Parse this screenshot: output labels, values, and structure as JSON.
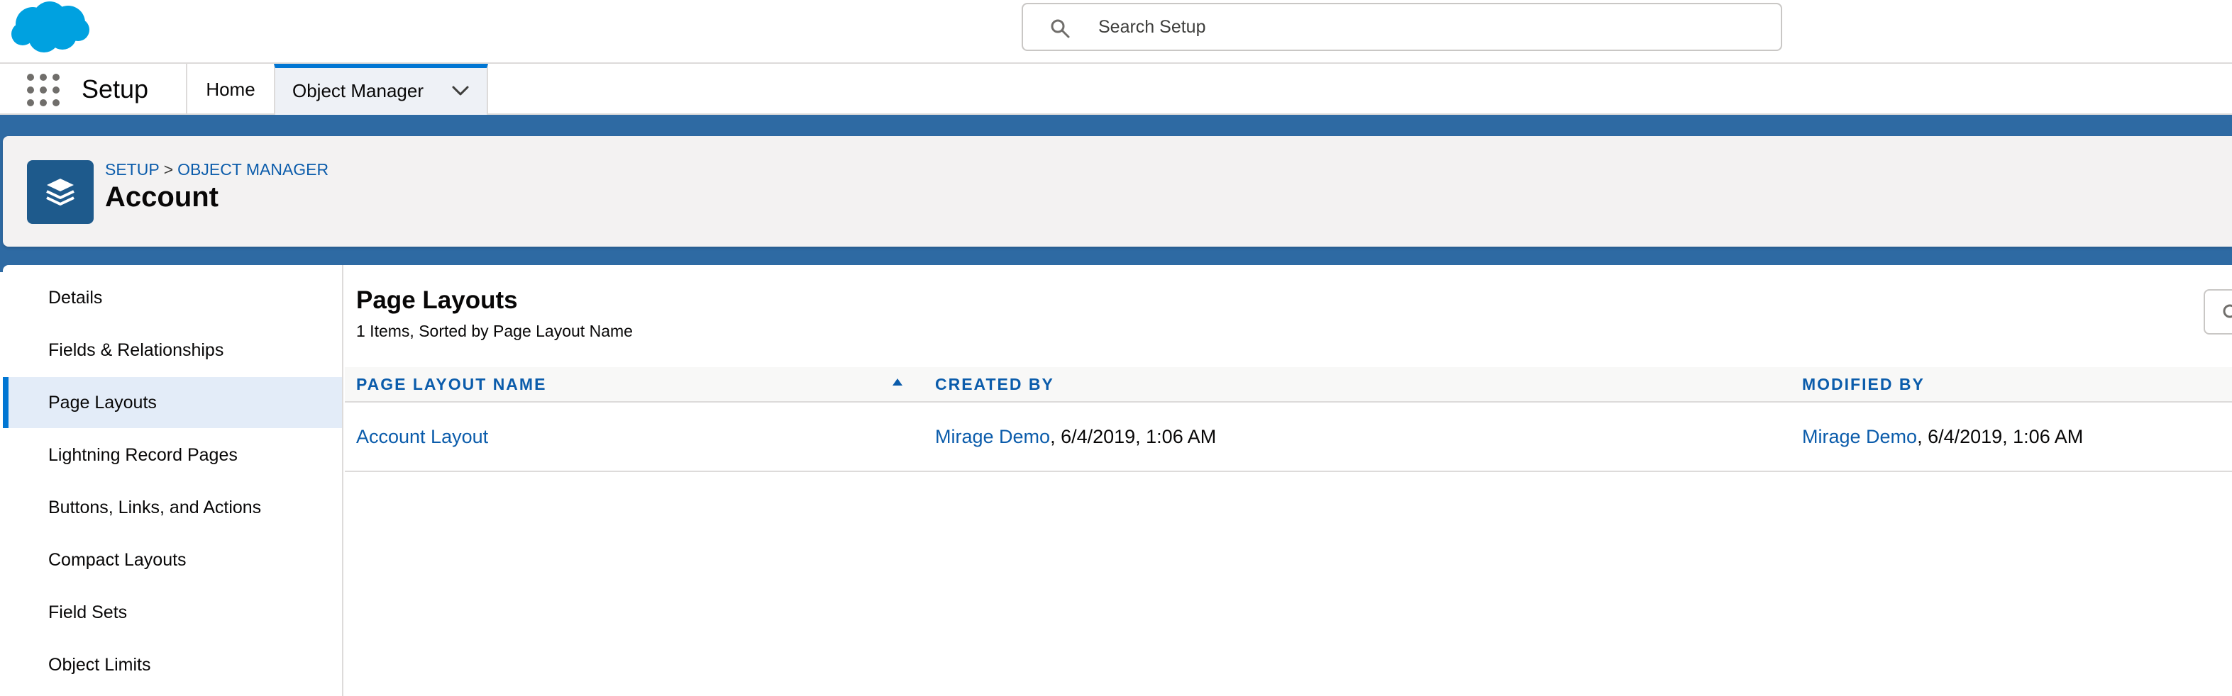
{
  "header": {
    "search_placeholder": "Search Setup"
  },
  "nav": {
    "app_name": "Setup",
    "tabs": [
      {
        "label": "Home"
      },
      {
        "label": "Object Manager"
      }
    ]
  },
  "page_header": {
    "breadcrumb": [
      "SETUP",
      "OBJECT MANAGER"
    ],
    "breadcrumb_separator": ">",
    "title": "Account"
  },
  "sidebar": {
    "items": [
      {
        "label": "Details"
      },
      {
        "label": "Fields & Relationships"
      },
      {
        "label": "Page Layouts",
        "active": true
      },
      {
        "label": "Lightning Record Pages"
      },
      {
        "label": "Buttons, Links, and Actions"
      },
      {
        "label": "Compact Layouts"
      },
      {
        "label": "Field Sets"
      },
      {
        "label": "Object Limits"
      }
    ]
  },
  "main": {
    "title": "Page Layouts",
    "subtitle": "1 Items, Sorted by Page Layout Name",
    "columns": [
      "PAGE LAYOUT NAME",
      "CREATED BY",
      "MODIFIED BY"
    ],
    "rows": [
      {
        "name": "Account Layout",
        "created_by_user": "Mirage Demo",
        "created_by_date": ", 6/4/2019, 1:06 AM",
        "modified_by_user": "Mirage Demo",
        "modified_by_date": ", 6/4/2019, 1:06 AM"
      }
    ]
  },
  "colors": {
    "brand_blue": "#0176d3",
    "link_blue": "#0b5cab",
    "band_blue": "#2e6aa3",
    "object_icon_bg": "#1e5a8c"
  }
}
